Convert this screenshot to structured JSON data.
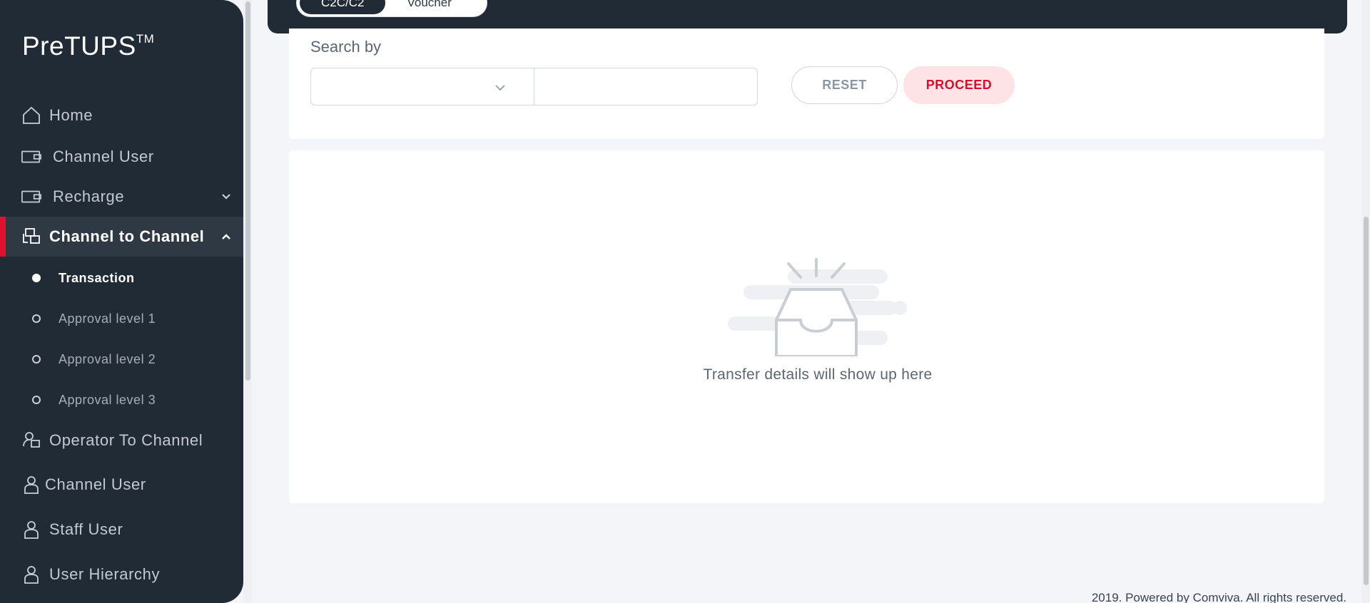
{
  "brand": {
    "name": "PreTUPS",
    "tm": "TM"
  },
  "sidebar": {
    "items": [
      {
        "label": "Home",
        "icon": "home-icon"
      },
      {
        "label": "Channel User",
        "icon": "wallet-icon"
      },
      {
        "label": "Recharge",
        "icon": "wallet-icon",
        "expandable": true
      },
      {
        "label": "Channel to Channel",
        "icon": "transfer-icon",
        "expandable": true,
        "active": true
      },
      {
        "label": "Operator To Channel",
        "icon": "operator-transfer-icon"
      },
      {
        "label": "Channel User",
        "icon": "user-icon"
      },
      {
        "label": "Staff User",
        "icon": "user-icon"
      },
      {
        "label": "User Hierarchy",
        "icon": "user-icon"
      }
    ],
    "subitems": [
      {
        "label": "Transaction",
        "active": true
      },
      {
        "label": "Approval level 1"
      },
      {
        "label": "Approval level 2"
      },
      {
        "label": "Approval level 3"
      }
    ]
  },
  "toggle": {
    "options": [
      "C2C/C2",
      "Voucher"
    ],
    "selected": "C2C/C2"
  },
  "search": {
    "label": "Search by",
    "select_value": "",
    "input_value": "",
    "reset_label": "RESET",
    "proceed_label": "PROCEED"
  },
  "empty_state": {
    "message": "Transfer details will show up here",
    "icon": "empty-inbox-icon"
  },
  "footer": {
    "text": "2019. Powered by Comviva. All rights reserved."
  },
  "colors": {
    "sidebar_bg": "#212b36",
    "accent_red": "#e0102e",
    "proceed_bg": "#fde3e6",
    "page_bg": "#f3f5f8"
  }
}
